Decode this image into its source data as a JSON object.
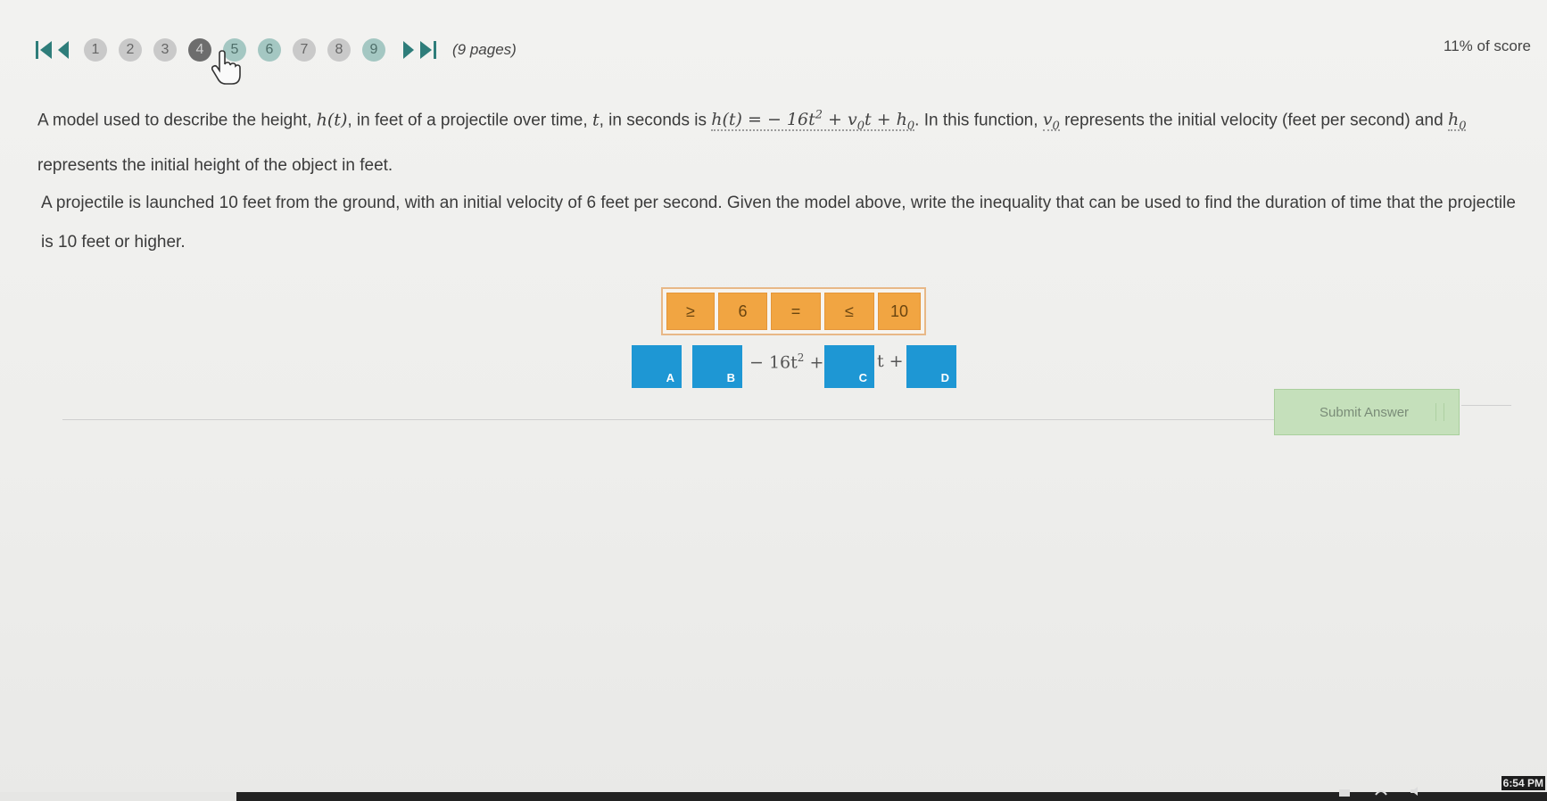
{
  "pager": {
    "pages": [
      "1",
      "2",
      "3",
      "4",
      "5",
      "6",
      "7",
      "8",
      "9"
    ],
    "current_page": 4,
    "page_count_label": "(9 pages)"
  },
  "score": "11% of score",
  "question": {
    "p1_a": "A model used to describe the height, ",
    "h_t": "h(t)",
    "p1_b": ", in feet of a projectile over time, ",
    "t": "t",
    "p1_c": ", in seconds is ",
    "formula_lhs": "h(t) = − 16t",
    "formula_exp": "2",
    "formula_mid": " + v",
    "formula_sub1": "0",
    "formula_t": "t + h",
    "formula_sub2": "0",
    "p1_d": ". In this function, ",
    "v0_base": "v",
    "v0_sub": "0",
    "p1_e": " represents the initial velocity (feet per second) and ",
    "h0_base": "h",
    "h0_sub": "0",
    "p1_f": " represents the initial height of the object in feet.",
    "p2": "A projectile is launched 10 feet from the ground, with an initial velocity of 6 feet per second. Given the model above, write the inequality that can be used to find the duration of time that the projectile is 10 feet or higher."
  },
  "tiles": [
    "≥",
    "6",
    "=",
    "≤",
    "10"
  ],
  "slots": {
    "a": "A",
    "b": "B",
    "c": "C",
    "d": "D"
  },
  "expression": {
    "part1": "− 16t",
    "part1_exp": "2",
    "part1_suffix": " +",
    "part2": "t +"
  },
  "submit_label": "Submit Answer",
  "taskbar": {
    "clock": "6:54 PM"
  },
  "colors": {
    "tile": "#f1a542",
    "slot": "#1e97d4",
    "submit": "#c5e0bb"
  }
}
